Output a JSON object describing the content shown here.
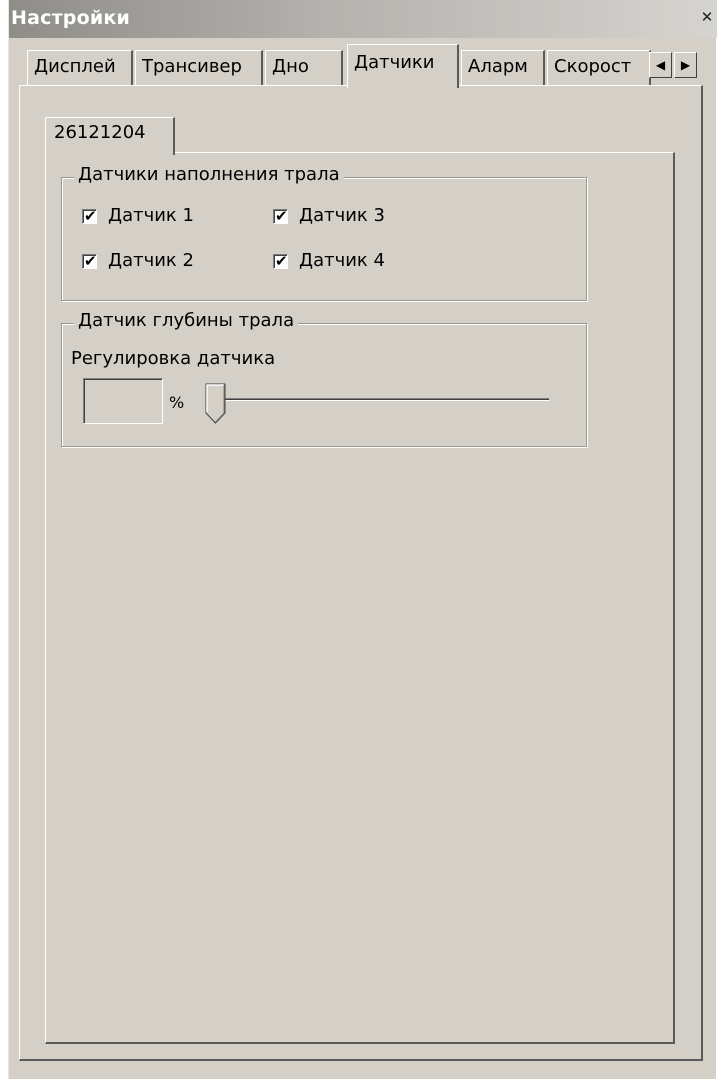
{
  "window": {
    "title": "Настройки",
    "close_glyph": "✕"
  },
  "tabs": [
    {
      "label": "Дисплей",
      "active": false
    },
    {
      "label": "Трансивер",
      "active": false
    },
    {
      "label": "Дно",
      "active": false
    },
    {
      "label": "Датчики",
      "active": true
    },
    {
      "label": "Аларм",
      "active": false
    },
    {
      "label": "Скорост",
      "active": false
    }
  ],
  "tab_scroll": {
    "left_glyph": "◀",
    "right_glyph": "▶"
  },
  "sub_tab": {
    "label": "26121204"
  },
  "fill_group": {
    "legend": "Датчики наполнения трала",
    "sensors": [
      {
        "label": "Датчик 1",
        "checked": true
      },
      {
        "label": "Датчик 2",
        "checked": true
      },
      {
        "label": "Датчик 3",
        "checked": true
      },
      {
        "label": "Датчик 4",
        "checked": true
      }
    ],
    "check_glyph": "✔"
  },
  "depth_group": {
    "legend": "Датчик глубины трала",
    "adjust_label": "Регулировка датчика",
    "value": "",
    "unit": "%",
    "slider_value": 0
  }
}
